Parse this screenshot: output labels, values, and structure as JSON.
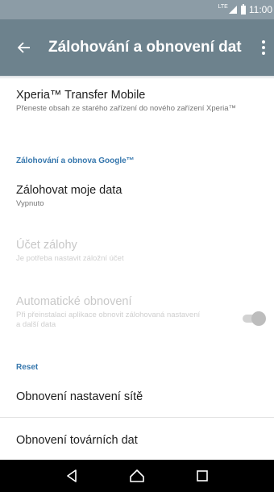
{
  "status_bar": {
    "network": "LTE",
    "time": "11:00"
  },
  "app_bar": {
    "title": "Zálohování a obnovení dat",
    "back_icon": "arrow-back-icon",
    "menu_icon": "overflow-menu-icon"
  },
  "items": {
    "xperia_transfer": {
      "title": "Xperia™ Transfer Mobile",
      "summary": "Přeneste obsah ze starého zařízení do nového zařízení Xperia™"
    },
    "google_section": "Zálohování a obnova Google™",
    "backup_data": {
      "title": "Zálohovat moje data",
      "summary": "Vypnuto"
    },
    "backup_account": {
      "title": "Účet zálohy",
      "summary": "Je potřeba nastavit záložní účet"
    },
    "auto_restore": {
      "title": "Automatické obnovení",
      "summary": "Při přeinstalaci aplikace obnovit zálohovaná nastavení a další data",
      "enabled": true
    },
    "reset_section": "Reset",
    "network_reset": {
      "title": "Obnovení nastavení sítě"
    },
    "factory_reset": {
      "title": "Obnovení továrních dat"
    }
  },
  "nav_bar": {
    "back": "nav-back-icon",
    "home": "nav-home-icon",
    "recents": "nav-recents-icon"
  },
  "colors": {
    "app_bar": "#6d828d",
    "status_bar": "#8c9ca6",
    "accent": "#3677ad"
  }
}
